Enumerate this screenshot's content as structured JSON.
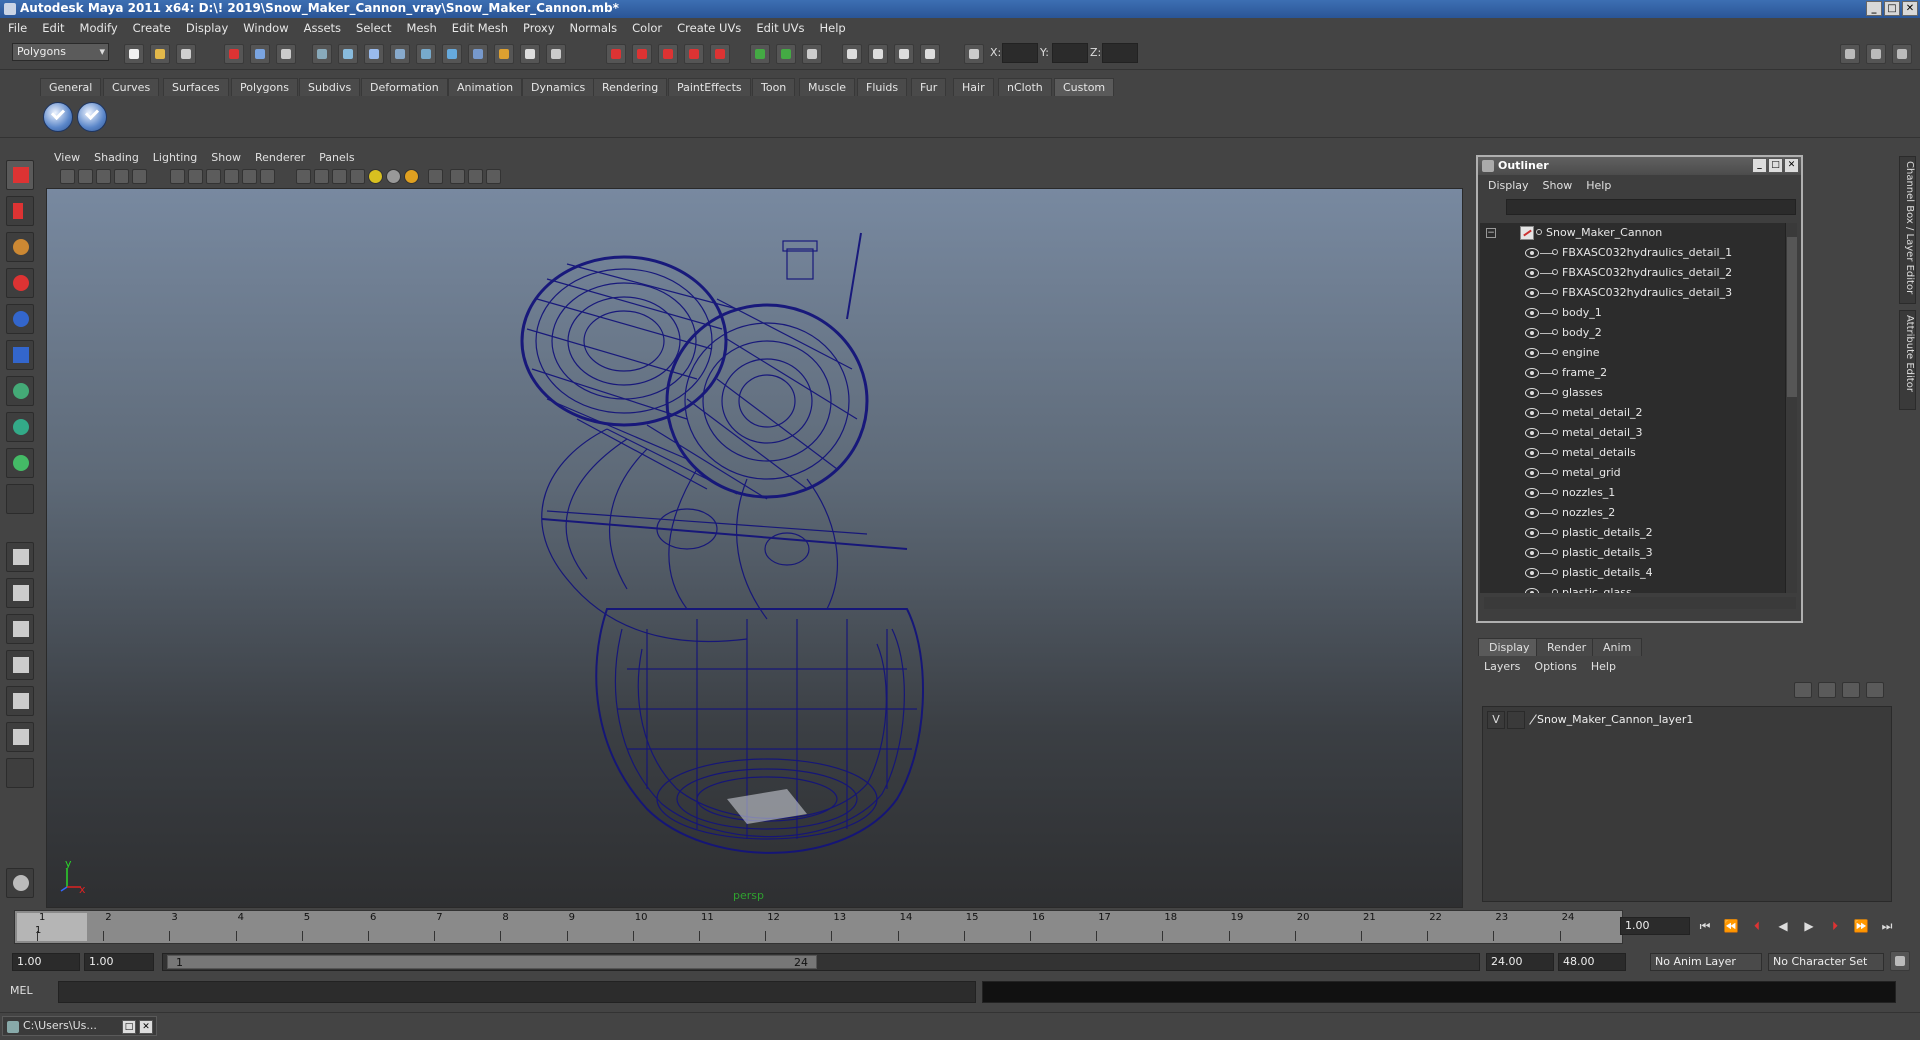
{
  "window": {
    "title": "Autodesk Maya 2011 x64: D:\\! 2019\\Snow_Maker_Cannon_vray\\Snow_Maker_Cannon.mb*"
  },
  "menubar": [
    "File",
    "Edit",
    "Modify",
    "Create",
    "Display",
    "Window",
    "Assets",
    "Select",
    "Mesh",
    "Edit Mesh",
    "Proxy",
    "Normals",
    "Color",
    "Create UVs",
    "Edit UVs",
    "Help"
  ],
  "statusline": {
    "mode": "Polygons",
    "x_label": "X:",
    "y_label": "Y:",
    "z_label": "Z:"
  },
  "shelf_tabs": [
    "General",
    "Curves",
    "Surfaces",
    "Polygons",
    "Subdivs",
    "Deformation",
    "Animation",
    "Dynamics",
    "Rendering",
    "PaintEffects",
    "Toon",
    "Muscle",
    "Fluids",
    "Fur",
    "Hair",
    "nCloth",
    "Custom"
  ],
  "shelf_active_tab": "Custom",
  "viewport": {
    "menu": [
      "View",
      "Shading",
      "Lighting",
      "Show",
      "Renderer",
      "Panels"
    ],
    "camera_label": "persp",
    "axis_x": "x",
    "axis_y": "y"
  },
  "outliner": {
    "title": "Outliner",
    "menu": [
      "Display",
      "Show",
      "Help"
    ],
    "root": "Snow_Maker_Cannon",
    "items": [
      "FBXASC032hydraulics_detail_1",
      "FBXASC032hydraulics_detail_2",
      "FBXASC032hydraulics_detail_3",
      "body_1",
      "body_2",
      "engine",
      "frame_2",
      "glasses",
      "metal_detail_2",
      "metal_detail_3",
      "metal_details",
      "metal_grid",
      "nozzles_1",
      "nozzles_2",
      "plastic_details_2",
      "plastic_details_3",
      "plastic_details_4",
      "plastic_glass"
    ]
  },
  "side_tabs": [
    "Channel Box / Layer Editor",
    "Attribute Editor"
  ],
  "layer_editor": {
    "tabs": [
      "Display",
      "Render",
      "Anim"
    ],
    "active_tab": "Display",
    "menu": [
      "Layers",
      "Options",
      "Help"
    ],
    "layers": [
      {
        "visible": "V",
        "name": "Snow_Maker_Cannon_layer1"
      }
    ]
  },
  "timeline": {
    "ticks": [
      "1",
      "2",
      "3",
      "4",
      "5",
      "6",
      "7",
      "8",
      "9",
      "10",
      "11",
      "12",
      "13",
      "14",
      "15",
      "16",
      "17",
      "18",
      "19",
      "20",
      "21",
      "22",
      "23",
      "24"
    ],
    "start_marker": "1",
    "current_frame": "1.00"
  },
  "range": {
    "start": "1.00",
    "playback_start": "1.00",
    "slider_start": "1",
    "slider_end": "24",
    "playback_end": "24.00",
    "end": "48.00",
    "anim_layer": "No Anim Layer",
    "character_set": "No Character Set"
  },
  "mel": {
    "label": "MEL"
  },
  "taskbar": {
    "item": "C:\\Users\\Us..."
  }
}
